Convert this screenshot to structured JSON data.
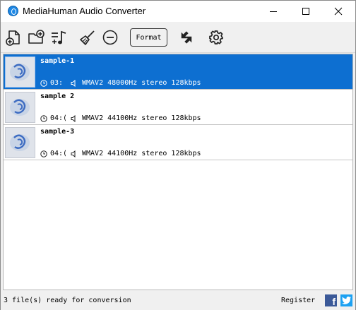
{
  "window": {
    "title": "MediaHuman Audio Converter"
  },
  "toolbar": {
    "format_label": "Format"
  },
  "files": [
    {
      "name": "sample-1",
      "duration": "03:",
      "info": "WMAV2 48000Hz stereo 128kbps",
      "selected": true
    },
    {
      "name": "sample 2",
      "duration": "04:(",
      "info": "WMAV2 44100Hz stereo 128kbps",
      "selected": false
    },
    {
      "name": "sample-3",
      "duration": "04:(",
      "info": "WMAV2 44100Hz stereo 128kbps",
      "selected": false
    }
  ],
  "status": {
    "text": "3 file(s) ready for conversion",
    "register_label": "Register"
  },
  "colors": {
    "selection": "#0d6fd1",
    "facebook": "#3b5998",
    "twitter": "#1da1f2"
  }
}
